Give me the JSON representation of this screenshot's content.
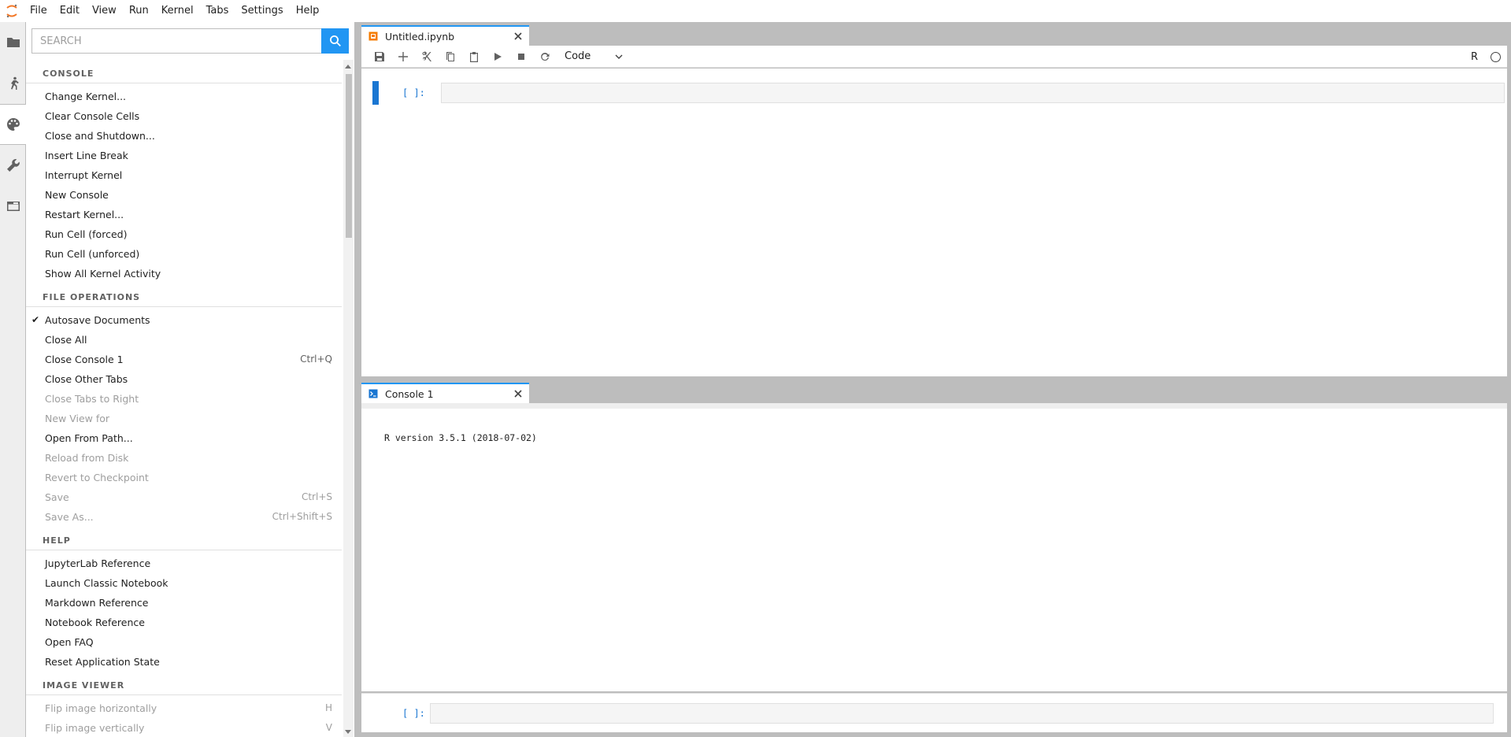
{
  "menubar": {
    "items": [
      "File",
      "Edit",
      "View",
      "Run",
      "Kernel",
      "Tabs",
      "Settings",
      "Help"
    ]
  },
  "sidebar": {
    "icons": [
      "folder-icon",
      "running-icon",
      "palette-icon",
      "wrench-icon",
      "tabs-icon"
    ]
  },
  "palette": {
    "search_placeholder": "SEARCH",
    "sections": [
      {
        "header": "CONSOLE",
        "items": [
          {
            "label": "Change Kernel...",
            "shortcut": "",
            "disabled": false,
            "checked": false
          },
          {
            "label": "Clear Console Cells",
            "shortcut": "",
            "disabled": false,
            "checked": false
          },
          {
            "label": "Close and Shutdown...",
            "shortcut": "",
            "disabled": false,
            "checked": false
          },
          {
            "label": "Insert Line Break",
            "shortcut": "",
            "disabled": false,
            "checked": false
          },
          {
            "label": "Interrupt Kernel",
            "shortcut": "",
            "disabled": false,
            "checked": false
          },
          {
            "label": "New Console",
            "shortcut": "",
            "disabled": false,
            "checked": false
          },
          {
            "label": "Restart Kernel...",
            "shortcut": "",
            "disabled": false,
            "checked": false
          },
          {
            "label": "Run Cell (forced)",
            "shortcut": "",
            "disabled": false,
            "checked": false
          },
          {
            "label": "Run Cell (unforced)",
            "shortcut": "",
            "disabled": false,
            "checked": false
          },
          {
            "label": "Show All Kernel Activity",
            "shortcut": "",
            "disabled": false,
            "checked": false
          }
        ]
      },
      {
        "header": "FILE OPERATIONS",
        "items": [
          {
            "label": "Autosave Documents",
            "shortcut": "",
            "disabled": false,
            "checked": true
          },
          {
            "label": "Close All",
            "shortcut": "",
            "disabled": false,
            "checked": false
          },
          {
            "label": "Close Console 1",
            "shortcut": "Ctrl+Q",
            "disabled": false,
            "checked": false
          },
          {
            "label": "Close Other Tabs",
            "shortcut": "",
            "disabled": false,
            "checked": false
          },
          {
            "label": "Close Tabs to Right",
            "shortcut": "",
            "disabled": true,
            "checked": false
          },
          {
            "label": "New View for",
            "shortcut": "",
            "disabled": true,
            "checked": false
          },
          {
            "label": "Open From Path...",
            "shortcut": "",
            "disabled": false,
            "checked": false
          },
          {
            "label": "Reload from Disk",
            "shortcut": "",
            "disabled": true,
            "checked": false
          },
          {
            "label": "Revert to Checkpoint",
            "shortcut": "",
            "disabled": true,
            "checked": false
          },
          {
            "label": "Save",
            "shortcut": "Ctrl+S",
            "disabled": true,
            "checked": false
          },
          {
            "label": "Save As...",
            "shortcut": "Ctrl+Shift+S",
            "disabled": true,
            "checked": false
          }
        ]
      },
      {
        "header": "HELP",
        "items": [
          {
            "label": "JupyterLab Reference",
            "shortcut": "",
            "disabled": false,
            "checked": false
          },
          {
            "label": "Launch Classic Notebook",
            "shortcut": "",
            "disabled": false,
            "checked": false
          },
          {
            "label": "Markdown Reference",
            "shortcut": "",
            "disabled": false,
            "checked": false
          },
          {
            "label": "Notebook Reference",
            "shortcut": "",
            "disabled": false,
            "checked": false
          },
          {
            "label": "Open FAQ",
            "shortcut": "",
            "disabled": false,
            "checked": false
          },
          {
            "label": "Reset Application State",
            "shortcut": "",
            "disabled": false,
            "checked": false
          }
        ]
      },
      {
        "header": "IMAGE VIEWER",
        "items": [
          {
            "label": "Flip image horizontally",
            "shortcut": "H",
            "disabled": true,
            "checked": false
          },
          {
            "label": "Flip image vertically",
            "shortcut": "V",
            "disabled": true,
            "checked": false
          }
        ]
      }
    ]
  },
  "notebook": {
    "tab_label": "Untitled.ipynb",
    "cell_type": "Code",
    "kernel_name": "R",
    "cell_prompt": "[ ]:"
  },
  "console": {
    "tab_label": "Console 1",
    "banner": "R version 3.5.1 (2018-07-02)",
    "prompt": "[ ]:"
  },
  "colors": {
    "accent": "#2196f3",
    "prompt": "#1976d2",
    "notebook_icon": "#f57c00"
  }
}
